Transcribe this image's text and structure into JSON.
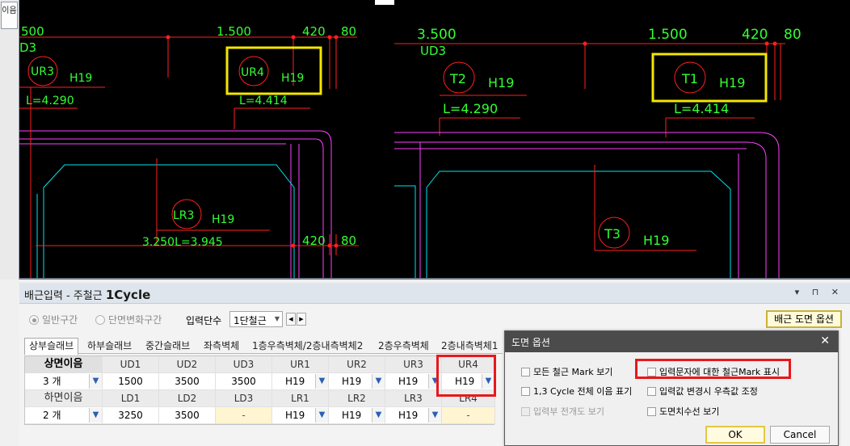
{
  "left_tab": {
    "label": "이음"
  },
  "drawing_left": {
    "top_dims": [
      "500",
      "1.500",
      "420",
      "80"
    ],
    "label_ud": "D3",
    "marks": [
      {
        "mark": "UR3",
        "bar": "H19",
        "length": "L=4.290"
      },
      {
        "mark": "UR4",
        "bar": "H19",
        "length": "L=4.414"
      },
      {
        "mark": "LR3",
        "bar": "H19",
        "length": "3.250L=3.945"
      }
    ],
    "bottom_dims": [
      "420",
      "80"
    ]
  },
  "drawing_right": {
    "top_dims": [
      "3.500",
      "1.500",
      "420",
      "80"
    ],
    "label_ud": "UD3",
    "marks": [
      {
        "mark": "T2",
        "bar": "H19",
        "length": "L=4.290"
      },
      {
        "mark": "T1",
        "bar": "H19",
        "length": "L=4.414"
      },
      {
        "mark": "T3",
        "bar": "H19"
      }
    ]
  },
  "panel": {
    "title_prefix": "배근입력 - 주철근",
    "title_bold": "1Cycle",
    "controls": "▾ ⊓ ✕",
    "radio_general": "일반구간",
    "radio_section": "단면변화구간",
    "level_label": "입력단수",
    "level_value": "1단철근",
    "options_button": "배근 도면 옵션",
    "tabs": [
      "상부슬래브",
      "하부슬래브",
      "중간슬래브",
      "좌측벽체",
      "1층우측벽체/2층내측벽체2",
      "2층우측벽체",
      "2층내측벽체1"
    ]
  },
  "grid": {
    "top_headers": [
      "상면이음",
      "UD1",
      "UD2",
      "UD3",
      "UR1",
      "UR2",
      "UR3",
      "UR4"
    ],
    "top_values": [
      "3 개",
      "1500",
      "3500",
      "3500",
      "H19",
      "H19",
      "H19",
      "H19"
    ],
    "bottom_headers": [
      "하면이음",
      "LD1",
      "LD2",
      "LD3",
      "LR1",
      "LR2",
      "LR3",
      "LR4"
    ],
    "bottom_values": [
      "2 개",
      "3250",
      "3500",
      "-",
      "H19",
      "H19",
      "H19",
      "-"
    ]
  },
  "dialog": {
    "title": "도면 옵션",
    "close": "✕",
    "options": [
      {
        "label": "모든 철근 Mark 보기",
        "checked": false,
        "enabled": true
      },
      {
        "label": "입력문자에 대한 철근Mark 표시",
        "checked": false,
        "enabled": true
      },
      {
        "label": "1,3 Cycle 전체 이음 표기",
        "checked": false,
        "enabled": true
      },
      {
        "label": "입력값 변경시 우측값 조정",
        "checked": false,
        "enabled": true
      },
      {
        "label": "입력부 전개도 보기",
        "checked": false,
        "enabled": false
      },
      {
        "label": "도면치수선 보기",
        "checked": false,
        "enabled": true
      }
    ],
    "ok": "OK",
    "cancel": "Cancel"
  },
  "colors": {
    "cad_bg": "#000000",
    "rebar_red": "#ff2020",
    "wall_magenta": "#ff40ff",
    "cyan": "#00e5ee",
    "text_green": "#33ff33",
    "highlight_yellow": "#f4e600",
    "highlight_red": "#e8181b"
  }
}
